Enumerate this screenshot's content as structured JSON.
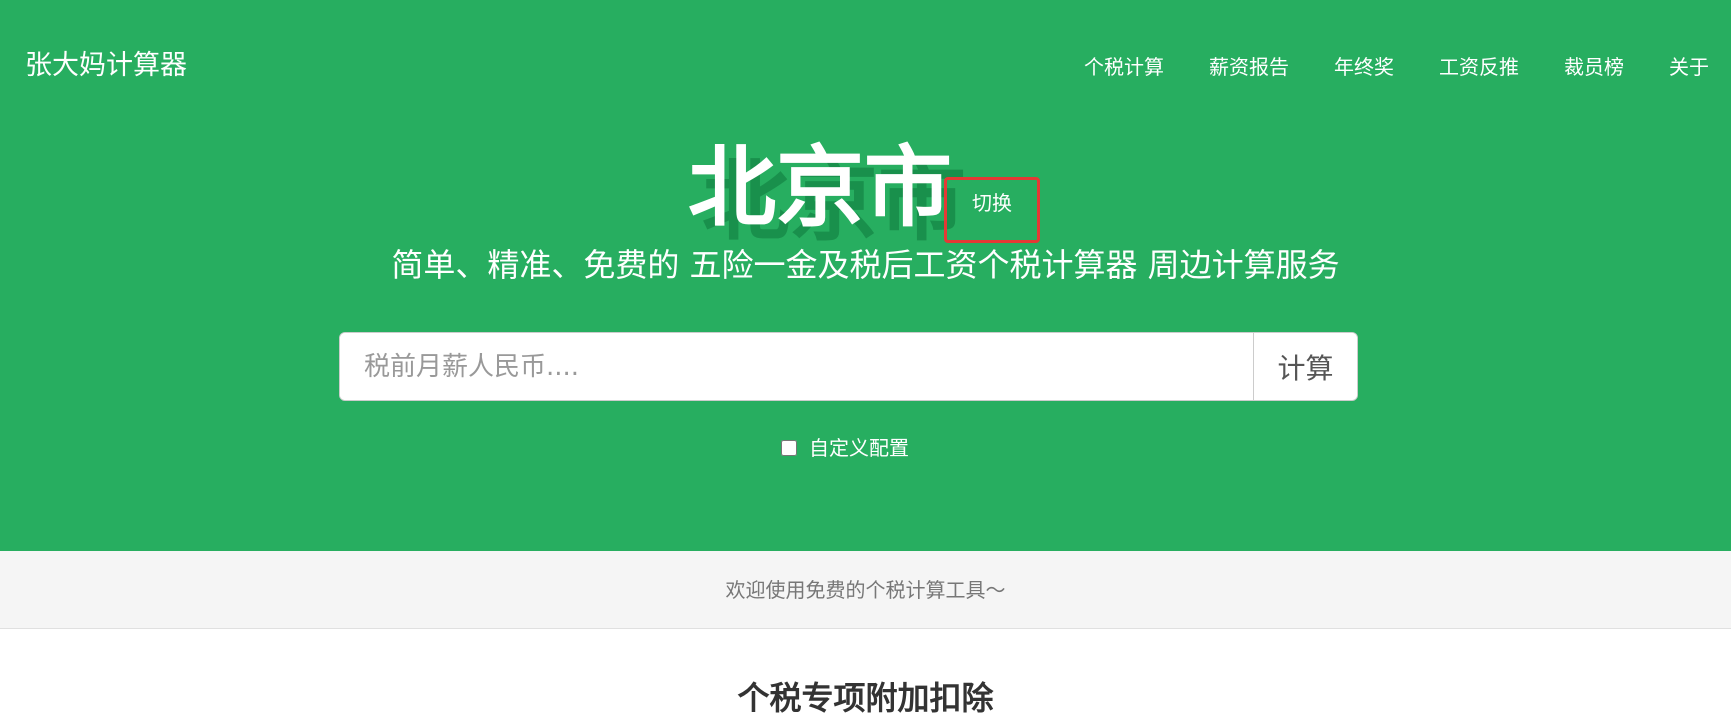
{
  "brand": "张大妈计算器",
  "nav": [
    {
      "label": "个税计算"
    },
    {
      "label": "薪资报告"
    },
    {
      "label": "年终奖"
    },
    {
      "label": "工资反推"
    },
    {
      "label": "裁员榜"
    },
    {
      "label": "关于"
    }
  ],
  "hero": {
    "city": "北京市",
    "switch_label": "切换",
    "subtitle": "简单、精准、免费的 五险一金及税后工资个税计算器 周边计算服务",
    "search": {
      "placeholder": "税前月薪人民币....",
      "value": "",
      "button_label": "计算"
    },
    "custom_config": {
      "label": "自定义配置",
      "checked": false
    }
  },
  "welcome": "欢迎使用免费的个税计算工具～",
  "section_title": "个税专项附加扣除",
  "colors": {
    "primary": "#27ae60",
    "highlight_border": "#e53935",
    "welcome_bg": "#f5f5f5"
  }
}
